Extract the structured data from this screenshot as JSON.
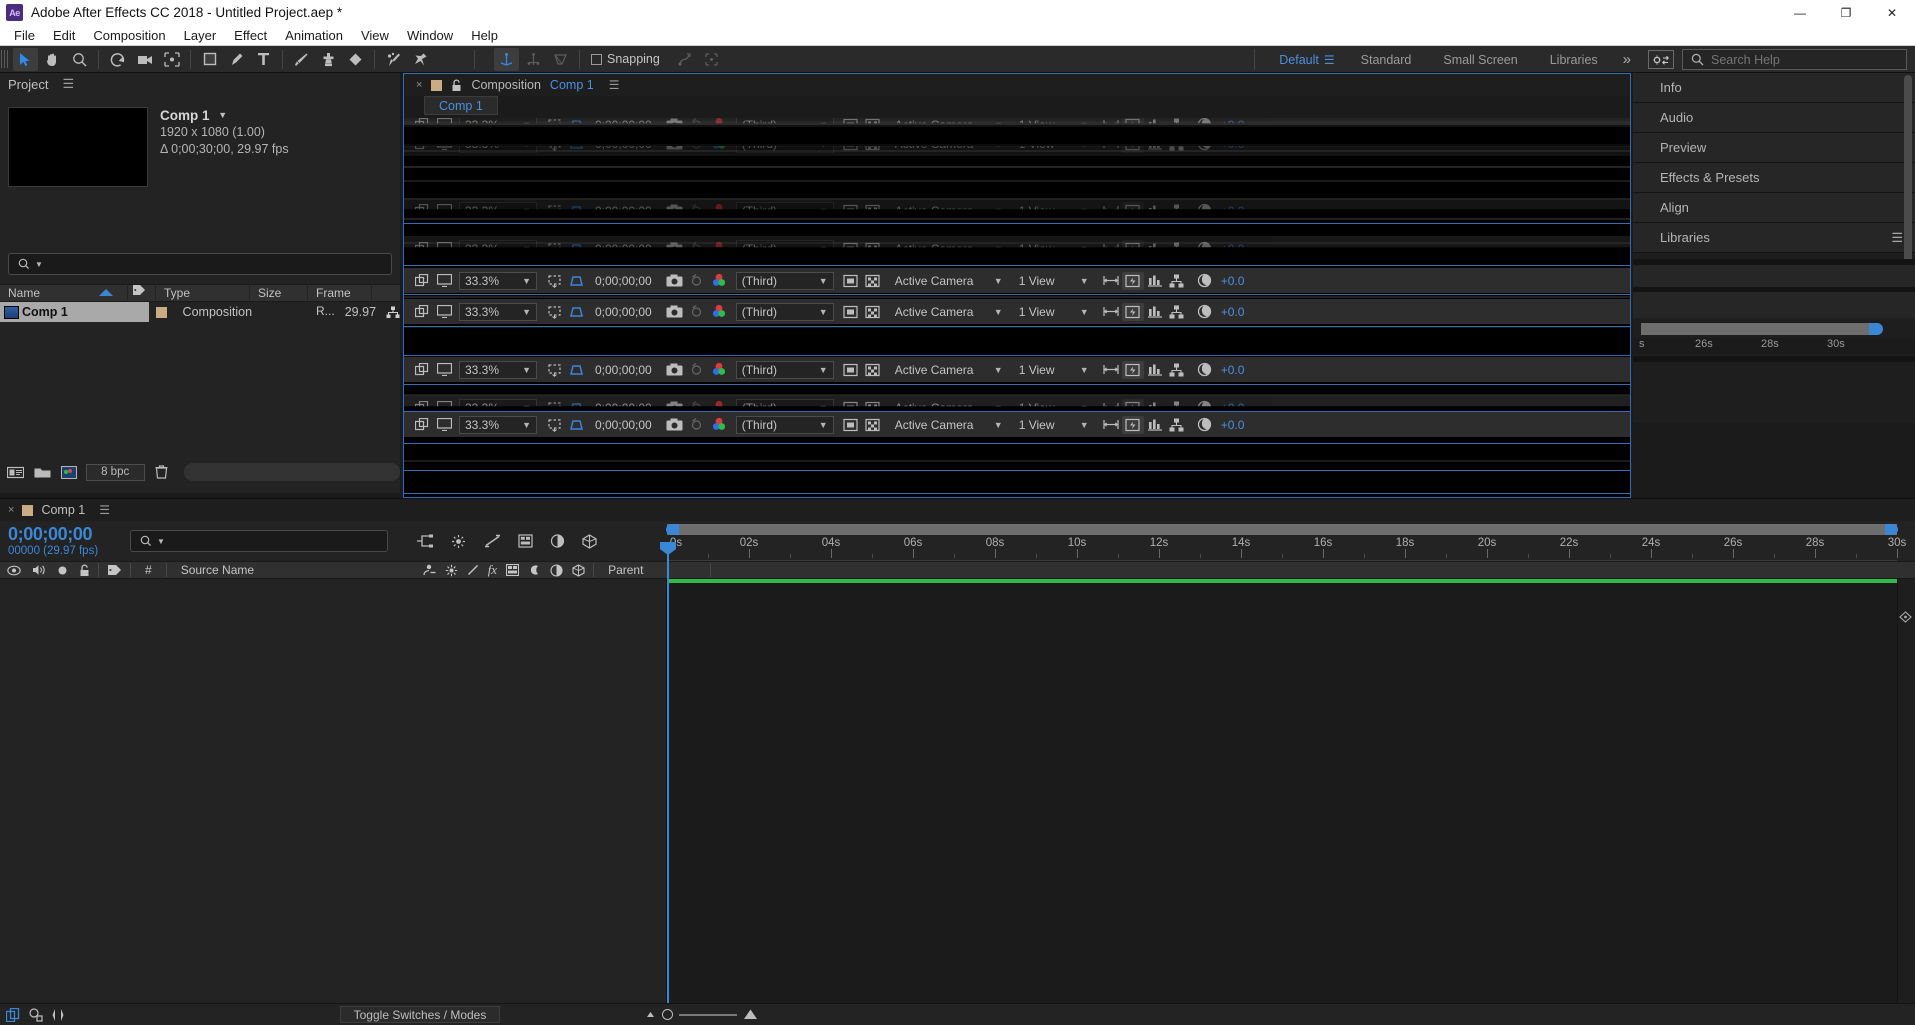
{
  "app": {
    "title": "Adobe After Effects CC 2018 - Untitled Project.aep *",
    "logo_text": "Ae",
    "window_controls": {
      "minimize": "—",
      "maximize": "❐",
      "close": "✕"
    }
  },
  "menubar": {
    "items": [
      "File",
      "Edit",
      "Composition",
      "Layer",
      "Effect",
      "Animation",
      "View",
      "Window",
      "Help"
    ]
  },
  "toolbar": {
    "tools": [
      {
        "name": "selection-tool",
        "active": true
      },
      {
        "name": "hand-tool",
        "active": false
      },
      {
        "name": "zoom-tool",
        "active": false
      },
      {
        "name": "rotation-tool",
        "active": false
      },
      {
        "name": "camera-tool",
        "active": false
      },
      {
        "name": "pan-behind-tool",
        "active": false
      },
      {
        "name": "shape-tool",
        "active": false
      },
      {
        "name": "pen-tool",
        "active": false
      },
      {
        "name": "type-tool",
        "active": false
      },
      {
        "name": "brush-tool",
        "active": false
      },
      {
        "name": "clone-stamp-tool",
        "active": false
      },
      {
        "name": "eraser-tool",
        "active": false
      },
      {
        "name": "roto-brush-tool",
        "active": false
      },
      {
        "name": "puppet-pin-tool",
        "active": false
      }
    ],
    "axis_tools": [
      "local-axis-mode",
      "world-axis-mode",
      "view-axis-mode"
    ],
    "snapping_label": "Snapping",
    "snapping_checked": false,
    "extra_tools": [
      "snap-align-icon",
      "snap-bounds-icon"
    ],
    "workspaces": [
      "Default",
      "Standard",
      "Small Screen",
      "Libraries"
    ],
    "workspace_selected": "Default",
    "overflow_label": "»",
    "search": {
      "placeholder": "Search Help",
      "value": ""
    }
  },
  "project_panel": {
    "tab_label": "Project",
    "menu_icon": "hamburger-icon",
    "comp": {
      "name": "Comp 1",
      "dimensions": "1920 x 1080 (1.00)",
      "duration": "Δ 0;00;30;00, 29.97 fps"
    },
    "search": {
      "placeholder": "",
      "value": ""
    },
    "columns": [
      "Name",
      "Type",
      "Size",
      "Frame R..."
    ],
    "rows": [
      {
        "name": "Comp 1",
        "type": "Composition",
        "size": "",
        "frame_rate": "29.97"
      }
    ],
    "footer": {
      "bit_depth": "8 bpc",
      "buttons": [
        "interpret-footage-icon",
        "new-folder-icon",
        "new-composition-icon",
        "delete-icon"
      ]
    }
  },
  "composition_panel": {
    "tab_close": "×",
    "lock_icon": "lock-icon",
    "title_prefix": "Composition",
    "title_name": "Comp 1",
    "menu_icon": "hamburger-icon",
    "sub_tab": "Comp 1",
    "viewer_bar": {
      "magnification": "33.3%",
      "timecode": "0;00;00;00",
      "resolution": "(Third)",
      "camera": "Active Camera",
      "views": "1 View",
      "exposure": "+0.0"
    },
    "glitch_note": "repeated-viewer-bar-render-artifact"
  },
  "right_panels": {
    "items": [
      {
        "label": "Info",
        "has_menu": false
      },
      {
        "label": "Audio",
        "has_menu": false
      },
      {
        "label": "Preview",
        "has_menu": false
      },
      {
        "label": "Effects & Presets",
        "has_menu": false
      },
      {
        "label": "Align",
        "has_menu": false
      },
      {
        "label": "Libraries",
        "has_menu": true
      }
    ],
    "glitch_ticks": [
      "s",
      "26s",
      "28s",
      "30s"
    ]
  },
  "timeline_panel": {
    "tab_close": "×",
    "tab_label": "Comp 1",
    "menu_icon": "hamburger-icon",
    "current_time": "0;00;00;00",
    "frame_info": "00000 (29.97 fps)",
    "search": {
      "placeholder": "",
      "value": ""
    },
    "tool_icons": [
      "composition-mini-flowchart-icon",
      "draft-3d-icon",
      "hide-shy-layers-icon",
      "frame-blending-icon",
      "motion-blur-icon",
      "graph-editor-icon"
    ],
    "columns": {
      "switch_icons": [
        "video-eye-icon",
        "audio-speaker-icon",
        "solo-icon",
        "lock-icon"
      ],
      "label_icon": "tag-icon",
      "number": "#",
      "source_name": "Source Name",
      "mode_icons": [
        "parent-pick-icon",
        "shy-icon",
        "collapse-icon",
        "fx-icon",
        "frame-blend-icon",
        "motion-blur-icon",
        "adjustment-icon",
        "3d-layer-icon"
      ],
      "parent": "Parent"
    },
    "ruler": {
      "labels": [
        "0s",
        "02s",
        "04s",
        "06s",
        "08s",
        "10s",
        "12s",
        "14s",
        "16s",
        "18s",
        "20s",
        "22s",
        "24s",
        "26s",
        "28s",
        "30s"
      ],
      "start": 0,
      "end": 30,
      "unit": "s"
    },
    "layers": []
  },
  "statusbar": {
    "left_icons": [
      "layer-switches-icon",
      "transfer-controls-icon",
      "in-out-panel-icon"
    ],
    "toggle_label": "Toggle Switches / Modes",
    "zoom_min_icon": "small-thumb-icon",
    "zoom_max_icon": "large-thumb-icon"
  },
  "colors": {
    "accent_blue": "#3b87d6",
    "panel_bg": "#232323",
    "workspace_bg": "#1b1b1b",
    "green_bar": "#2fbd4a",
    "tag_swatch": "#c9ab84"
  }
}
